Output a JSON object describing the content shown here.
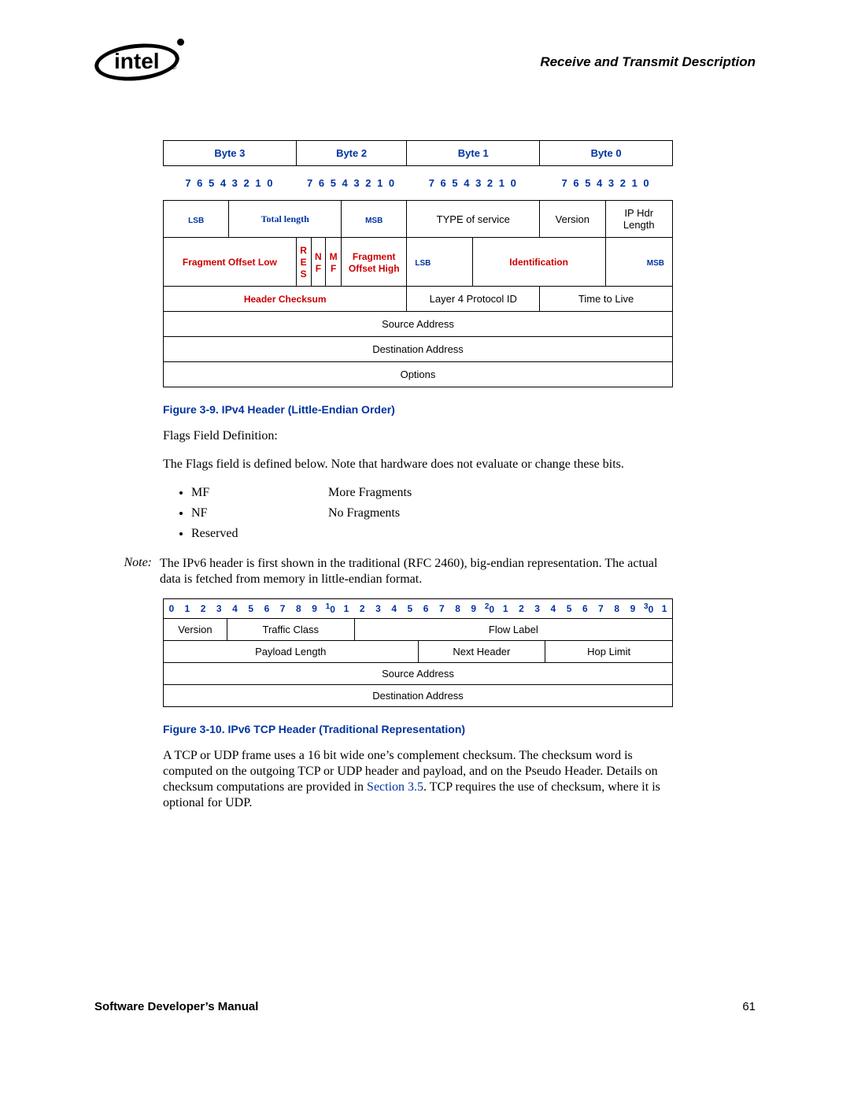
{
  "header": {
    "section_title": "Receive and Transmit Description",
    "logo_text": "intel",
    "logo_r": "®"
  },
  "ipv4": {
    "byte_headers": [
      "Byte 3",
      "Byte 2",
      "Byte 1",
      "Byte 0"
    ],
    "bit_row": "7  6  5  4  3  2  1  0",
    "row1": {
      "lsb": "LSB",
      "total_length": "Total length",
      "msb": "MSB",
      "type_of_service": "TYPE of service",
      "version": "Version",
      "ip_hdr_length": "IP Hdr Length"
    },
    "row2": {
      "fragment_offset_low": "Fragment Offset Low",
      "res": "R\nE\nS",
      "nf": "N\nF",
      "mf": "M\nF",
      "fragment_offset_high": "Fragment Offset High",
      "ident_lsb": "LSB",
      "identification": "Identification",
      "ident_msb": "MSB"
    },
    "row3": {
      "header_checksum": "Header Checksum",
      "layer4": "Layer 4 Protocol ID",
      "ttl": "Time to Live"
    },
    "row_source": "Source Address",
    "row_dest": "Destination Address",
    "row_options": "Options"
  },
  "fig9_caption": "Figure 3-9. IPv4 Header (Little-Endian Order)",
  "flags": {
    "heading": "Flags Field Definition:",
    "intro": "The Flags field is defined below. Note that hardware does not evaluate or change these bits.",
    "items": [
      {
        "code": "MF",
        "desc": "More Fragments"
      },
      {
        "code": "NF",
        "desc": "No Fragments"
      },
      {
        "code": "Reserved",
        "desc": ""
      }
    ]
  },
  "note": {
    "label": "Note:",
    "text": "The IPv6 header is first shown in the traditional (RFC 2460), big-endian representation. The actual data is fetched from memory in little-endian format."
  },
  "ipv6": {
    "bits_string": "0 1 2 3 4 5 6 7 8 9 10 1 2 3 4 5 6 7 8 9 20 1 2 3 4 5 6 7 8 9 30 1",
    "row1": {
      "version": "Version",
      "traffic_class": "Traffic Class",
      "flow_label": "Flow Label"
    },
    "row2": {
      "payload": "Payload Length",
      "next_header": "Next Header",
      "hop_limit": "Hop Limit"
    },
    "row_source": "Source Address",
    "row_dest": "Destination Address"
  },
  "fig10_caption": "Figure 3-10. IPv6 TCP Header (Traditional Representation)",
  "para2_pre": "A TCP or UDP frame uses a 16 bit wide one’s complement checksum. The checksum word is computed on the outgoing TCP or UDP header and payload, and on the Pseudo Header. Details on checksum computations are provided in ",
  "para2_link": "Section 3.5",
  "para2_post": ". TCP requires the use of checksum, where it is optional for UDP.",
  "footer": {
    "left": "Software Developer’s Manual",
    "right": "61"
  }
}
